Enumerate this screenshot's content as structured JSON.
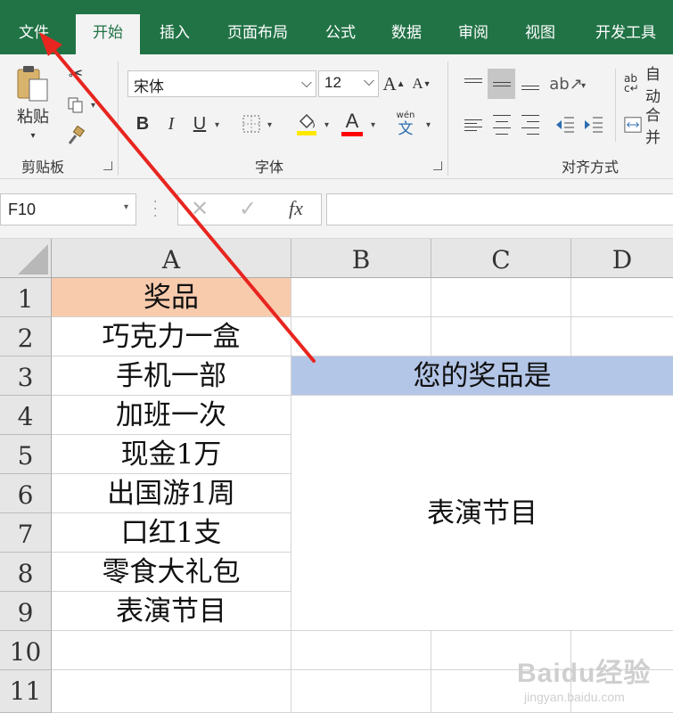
{
  "ribbon_tabs": [
    "文件",
    "开始",
    "插入",
    "页面布局",
    "公式",
    "数据",
    "审阅",
    "视图",
    "开发工具"
  ],
  "clipboard": {
    "paste_label": "粘贴",
    "group_label": "剪贴板"
  },
  "font": {
    "name": "宋体",
    "size": "12",
    "group_label": "字体",
    "bold": "B",
    "italic": "I",
    "underline": "U",
    "font_color_letter": "A",
    "phonetic_top": "wén",
    "phonetic_bottom": "文",
    "grow_letter": "A",
    "shrink_letter": "A"
  },
  "alignment": {
    "group_label": "对齐方式",
    "wrap_label": "自动",
    "merge_label": "合并"
  },
  "formula_bar": {
    "name_box": "F10",
    "fx_label": "fx",
    "formula": ""
  },
  "sheet": {
    "columns": [
      "A",
      "B",
      "C",
      "D"
    ],
    "rows": [
      "1",
      "2",
      "3",
      "4",
      "5",
      "6",
      "7",
      "8",
      "9",
      "10",
      "11"
    ],
    "column_a": [
      "奖品",
      "巧克力一盒",
      "手机一部",
      "加班一次",
      "现金1万",
      "出国游1周",
      "口红1支",
      "零食大礼包",
      "表演节目"
    ],
    "prompt": "您的奖品是",
    "result": "表演节目"
  },
  "watermark": {
    "brand": "Baidu经验",
    "url": "jingyan.baidu.com"
  },
  "colors": {
    "ribbon_green": "#217346",
    "header_fill": "#F8CBAD",
    "prompt_fill": "#B4C6E7",
    "arrow_red": "#E8251F"
  }
}
